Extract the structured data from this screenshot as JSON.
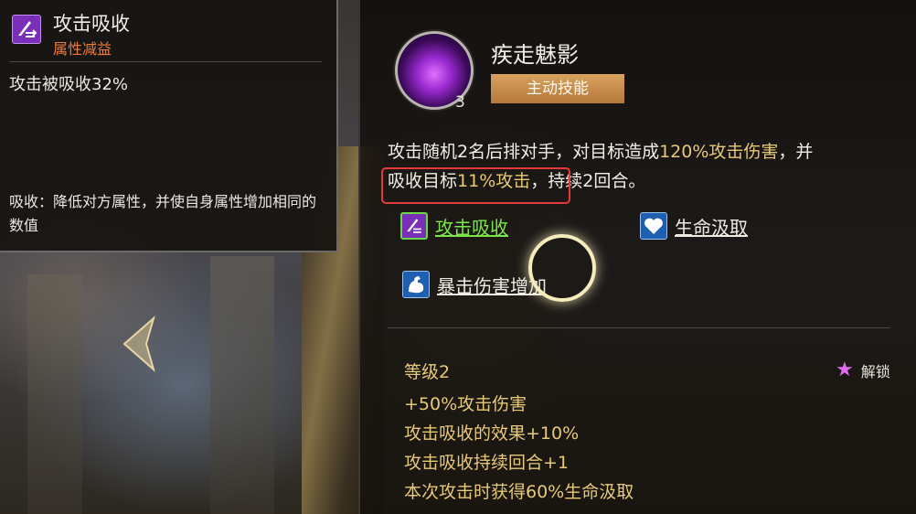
{
  "tooltip": {
    "title": "攻击吸收",
    "subtitle": "属性减益",
    "value": "攻击被吸收32%",
    "description": "吸收：降低对方属性，并使自身属性增加相同的数值",
    "icon": "absorb-buff-icon"
  },
  "skill": {
    "name": "疾走魅影",
    "type_label": "主动技能",
    "level_badge": "3",
    "desc_part1": "攻击随机2名后排对手，对目标造成",
    "desc_hl1": "120%攻击伤害",
    "desc_part2": "，并",
    "desc_part3": "吸收目标",
    "desc_hl2": "11%攻击",
    "desc_part4": "，",
    "desc_part5": "持续2回合。"
  },
  "links": {
    "absorb": "攻击吸收",
    "drain": "生命汲取",
    "crit": "暴击伤害增加"
  },
  "upgrade": {
    "level_title": "等级2",
    "unlock_label": "解锁",
    "effects": [
      "+50%攻击伤害",
      "攻击吸收的效果+10%",
      "攻击吸收持续回合+1",
      "本次攻击时获得60%生命汲取"
    ]
  },
  "colors": {
    "highlight": "#e8c978",
    "link_green": "#7be54a",
    "debuff_orange": "#f07a3a",
    "callout_red": "#e23a3a",
    "skill_tag": "#c98f4c"
  }
}
